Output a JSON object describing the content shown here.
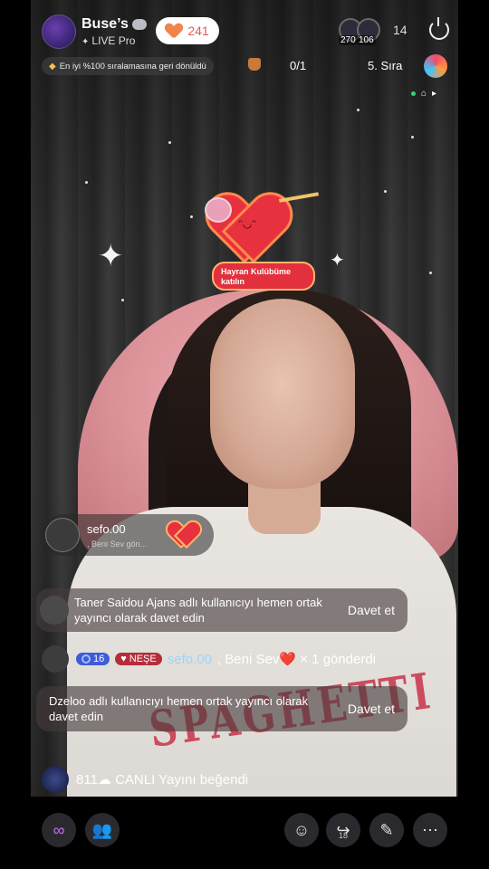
{
  "host": {
    "name": "Buse’s",
    "subtitle": "LIVE Pro",
    "likes": "241"
  },
  "viewers": {
    "avatar_counts": [
      "270",
      "106"
    ],
    "total": "14"
  },
  "rank": {
    "message": "En iyi %100 sıralamasına geri dönüldü",
    "score": "0/1",
    "place": "5. Sıra"
  },
  "fan_club": {
    "label": "Hayran Kulübüme katılın"
  },
  "gift": {
    "user": "sefo.00",
    "sub": ", Beni Sev  gön..."
  },
  "invites": [
    {
      "text": "Taner Saidou Ajans adlı kullanıcıyı hemen ortak yayıncı olarak davet edin",
      "button": "Davet et"
    },
    {
      "text": "Dzeloo adlı kullanıcıyı hemen ortak yayıncı olarak davet edin",
      "button": "Davet et"
    }
  ],
  "sender": {
    "level": "16",
    "fan_badge": "NEŞE",
    "name": "sefo.00",
    "action": ", Beni Sev❤️ × 1 gönderdi"
  },
  "liked": {
    "text": "811☁ CANLI Yayını beğendi"
  },
  "bottom": {
    "share_count": "18"
  },
  "colors": {
    "accent": "#c86cff",
    "like_heart": "#f0844d",
    "fan_red": "#e2313c"
  }
}
